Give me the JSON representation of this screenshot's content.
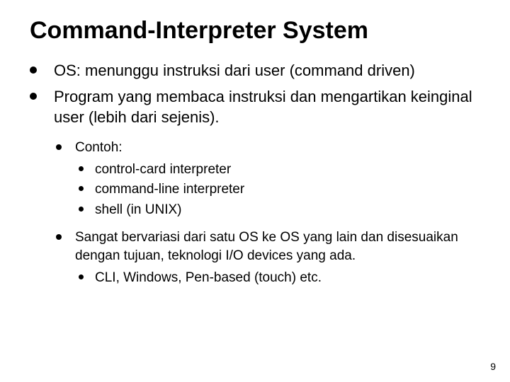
{
  "title": "Command-Interpreter System",
  "bullets": {
    "b1": "OS: menunggu instruksi dari user (command driven)",
    "b2": "Program yang membaca instruksi dan mengartikan keinginal user (lebih dari sejenis).",
    "b2_1": "Contoh:",
    "b2_1_1": "control-card interpreter",
    "b2_1_2": "command-line interpreter",
    "b2_1_3": "shell (in UNIX)",
    "b2_2": "Sangat bervariasi dari satu OS ke OS yang lain dan disesuaikan dengan tujuan, teknologi I/O devices yang ada.",
    "b2_2_1": "CLI, Windows, Pen-based (touch) etc."
  },
  "page_number": "9"
}
